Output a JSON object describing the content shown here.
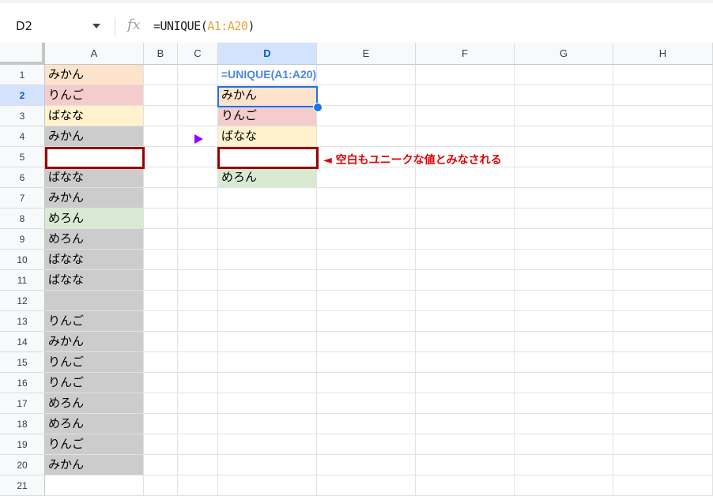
{
  "formula_bar": {
    "name_box": "D2",
    "fx": "fx",
    "formula_prefix": "=UNIQUE(",
    "formula_ref": "A1:A20",
    "formula_suffix": ")"
  },
  "columns": [
    "A",
    "B",
    "C",
    "D",
    "E",
    "F",
    "G",
    "H"
  ],
  "selected_column": "D",
  "rows": [
    "1",
    "2",
    "3",
    "4",
    "5",
    "6",
    "7",
    "8",
    "9",
    "10",
    "11",
    "12",
    "13",
    "14",
    "15",
    "16",
    "17",
    "18",
    "19",
    "20",
    "21"
  ],
  "selected_row": "2",
  "column_a": [
    "みかん",
    "りんご",
    "ばなな",
    "みかん",
    "",
    "ばなな",
    "みかん",
    "めろん",
    "めろん",
    "ばなな",
    "ばなな",
    "",
    "りんご",
    "みかん",
    "りんご",
    "りんご",
    "めろん",
    "めろん",
    "りんご",
    "みかん"
  ],
  "column_d": {
    "d1_label": "=UNIQUE(A1:A20)",
    "values": [
      "みかん",
      "りんご",
      "ばなな",
      "",
      "めろん"
    ]
  },
  "annotation": {
    "arrow": "◄",
    "text": "空白もユニークな値とみなされる"
  },
  "colors": {
    "orange": "#fde3cc",
    "red": "#f4cccc",
    "yellow": "#fff2cc",
    "gray": "#cccccc",
    "green": "#d9ead3",
    "highlight_border": "#990000",
    "annotation": "#e00000",
    "selection": "#1a73e8",
    "marker": "#9900ff"
  }
}
